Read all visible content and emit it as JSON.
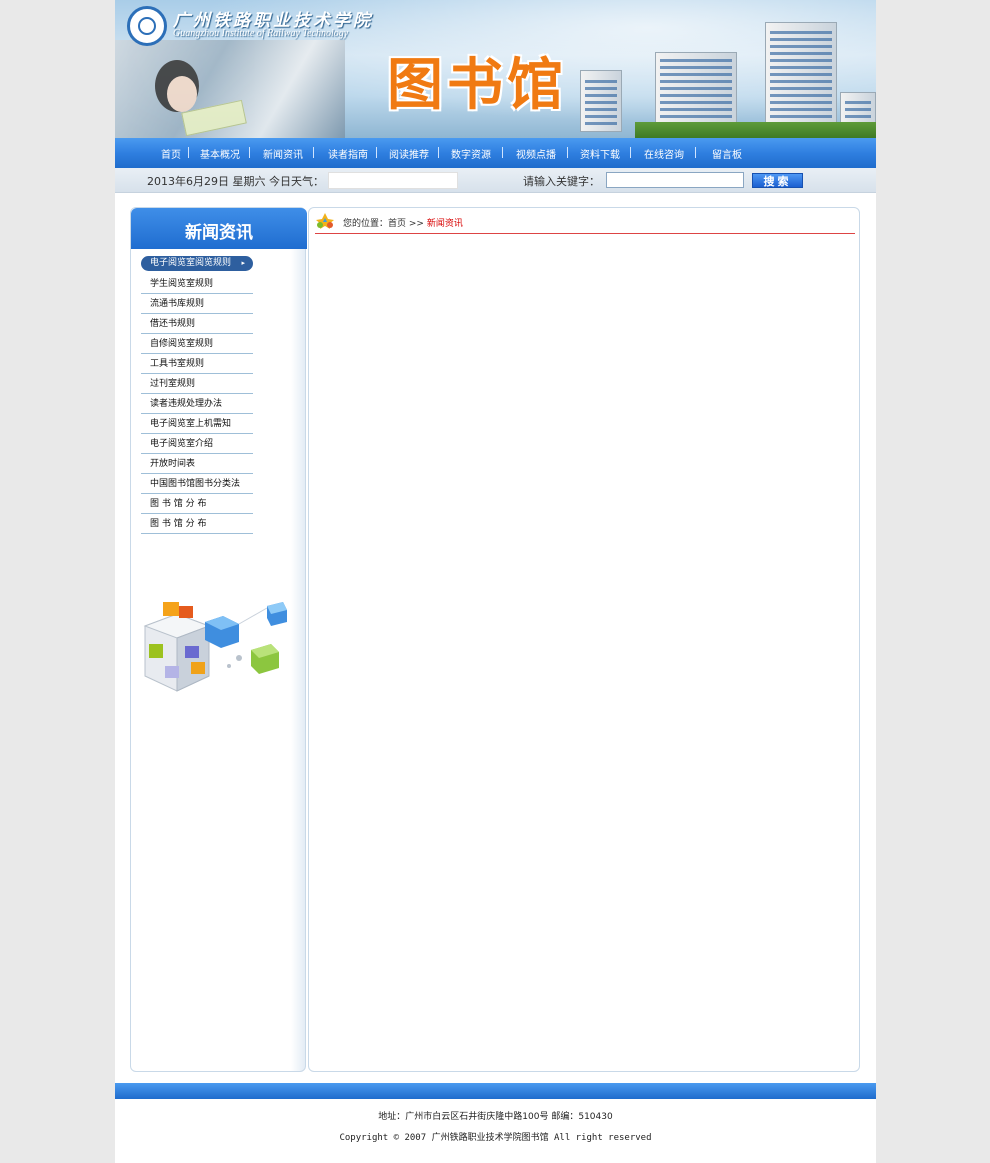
{
  "banner": {
    "school_cn": "广州铁路职业技术学院",
    "school_en": "Guangzhou Institute of Railway Technology",
    "library_title": "图书馆"
  },
  "nav": {
    "items": [
      {
        "label": "首页"
      },
      {
        "label": "基本概况"
      },
      {
        "label": "新闻资讯"
      },
      {
        "label": "读者指南"
      },
      {
        "label": "阅读推荐"
      },
      {
        "label": "数字资源"
      },
      {
        "label": "视频点播"
      },
      {
        "label": "资料下载"
      },
      {
        "label": "在线咨询"
      },
      {
        "label": "留言板"
      }
    ]
  },
  "infobar": {
    "date": "2013年6月29日  星期六  今日天气：",
    "keyword_label": "请输入关键字：",
    "search_value": "",
    "search_button": "搜索"
  },
  "sidebar": {
    "title": "新闻资讯",
    "items": [
      {
        "label": "电子阅览室阅览规则",
        "active": true
      },
      {
        "label": "学生阅览室规则"
      },
      {
        "label": "流通书库规则"
      },
      {
        "label": "借还书规则"
      },
      {
        "label": "自修阅览室规则"
      },
      {
        "label": "工具书室规则"
      },
      {
        "label": "过刊室规则"
      },
      {
        "label": "读者违规处理办法"
      },
      {
        "label": "电子阅览室上机需知"
      },
      {
        "label": "电子阅览室介绍"
      },
      {
        "label": "开放时间表"
      },
      {
        "label": "中国图书馆图书分类法"
      },
      {
        "label": "图 书 馆 分 布"
      },
      {
        "label": "图 书 馆 分 布"
      }
    ]
  },
  "breadcrumb": {
    "prefix": "您的位置：",
    "home": "首页",
    "sep": " >> ",
    "current": "新闻资讯"
  },
  "footer": {
    "address": "地址：广州市白云区石井街庆隆中路100号    邮编：510430",
    "copyright": "Copyright © 2007 广州铁路职业技术学院图书馆  All right reserved"
  }
}
